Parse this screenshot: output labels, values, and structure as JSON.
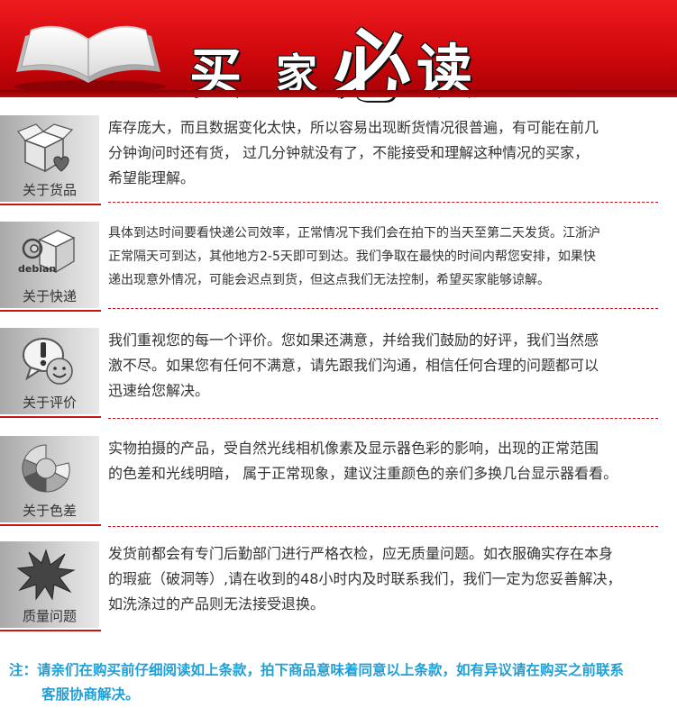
{
  "header": {
    "title_chars": [
      "买",
      "家",
      "必",
      "读"
    ],
    "colors": {
      "banner": "#d0080c",
      "title_text": "#ffffff"
    },
    "icon": "open-book-icon"
  },
  "rows": [
    {
      "label": "关于货品",
      "icon": "box-heart-icon",
      "lines": [
        "库存庞大，而且数据变化太快，所以容易出现断货情况很普遍，有可能在前几",
        "分钟询问时还有货， 过几分钟就没有了，不能接受和理解这种情况的买家，",
        "希望能理解。"
      ]
    },
    {
      "label": "关于快递",
      "icon": "debian-box-icon",
      "icon_text": "debian",
      "lines": [
        "具体到达时间要看快递公司效率，正常情况下我们会在拍下的当天至第二天发货。江浙沪",
        "正常隔天可到达，其他地方2-5天即可到达。我们争取在最快的时间内帮您安排，如果快",
        "递出现意外情况，可能会迟点到货，但这点我们无法控制，希望买家能够谅解。"
      ]
    },
    {
      "label": "关于评价",
      "icon": "chat-smiley-icon",
      "lines": [
        "我们重视您的每一个评价。您如果还满意，并给我们鼓励的好评，我们当然感",
        "激不尽。如果您有任何不满意，请先跟我们沟通，相信任何合理的问题都可以",
        "迅速给您解决。"
      ]
    },
    {
      "label": "关于色差",
      "icon": "color-wheel-icon",
      "lines": [
        "实物拍摄的产品，受自然光线相机像素及显示器色彩的影响，出现的正常范围",
        "的色差和光线明暗， 属于正常现象，建议注重颜色的亲们多换几台显示器看看。"
      ]
    },
    {
      "label": "质量问题",
      "icon": "burst-icon",
      "lines": [
        "发货前都会有专门后勤部门进行严格衣检，应无质量问题。如衣服确实存在本身",
        "的瑕疵（破洞等）,请在收到的48小时内及时联系我们，我们一定为您妥善解决，",
        "如洗涤过的产品则无法接受退换。"
      ]
    }
  ],
  "note": {
    "line1": "注：请亲们在购买前仔细阅读如上条款，拍下商品意味着同意以上条款，如有异议请在购买之前联系",
    "line2": "客服协商解决。",
    "color": "#1e9fd6"
  }
}
